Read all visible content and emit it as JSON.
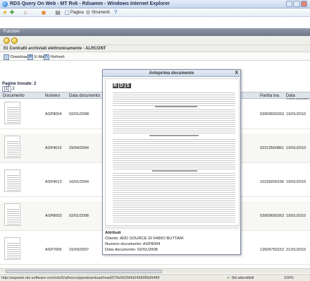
{
  "window": {
    "title": "RDS Query On Web - MT Rv6 - Rdsamm - Windows Internet Explorer"
  },
  "commandbar": {
    "page_label": "Pagina",
    "tools_label": "Strumenti"
  },
  "funzioni": {
    "label": "Funzioni"
  },
  "page": {
    "heading": "01 Contratti archiviati elettronicamente - ALRCONT"
  },
  "toolbar": {
    "download": "Download",
    "email": "E-Mail",
    "refresh": "Refresh"
  },
  "results": {
    "pagine_label": "Pagine trovate: 2",
    "pager": {
      "current": "[1]",
      "next": "2"
    },
    "columns": {
      "documento": "Documento",
      "numero": "Numero",
      "data_documento": "Data documento",
      "partita_iva": "Partita Iva",
      "data_caricamento": "Data caricamento"
    },
    "rows": [
      {
        "numero": "ASP8004",
        "data_documento": "02/01/2008",
        "partita_iva": "03909650263",
        "data_caricamento": "19/01/2010"
      },
      {
        "numero": "ASP4015",
        "data_documento": "29/04/2004",
        "partita_iva": "02313560861",
        "data_caricamento": "19/01/2010"
      },
      {
        "numero": "ASP4013",
        "data_documento": "16/01/2004",
        "partita_iva": "10239200156",
        "data_caricamento": "19/01/2010"
      },
      {
        "numero": "ASP8003",
        "data_documento": "02/01/2008",
        "partita_iva": "03909650263",
        "data_caricamento": "19/01/2010"
      },
      {
        "numero": "ASP7005",
        "data_documento": "15/03/2007",
        "partita_iva": "12605750152",
        "data_caricamento": "21/01/2010"
      }
    ]
  },
  "preview": {
    "title": "Anteprima documento",
    "close": "X",
    "logo": [
      "R",
      "D",
      "S"
    ],
    "attributes": {
      "heading": "Attributi",
      "cliente": "Cliente: ADD SOURCE DI FABIO BUTTARI",
      "numero": "Numero documento: ASP8004",
      "data": "Data documento: 02/01/2008"
    }
  },
  "statusbar": {
    "url": "http://aspweb.rds-software.com/rds/5/alfresco/ppwdownload/read/079e5625f4d24589f5bf94f0f",
    "zone": "Siti attendibili",
    "zoom": "100%"
  }
}
